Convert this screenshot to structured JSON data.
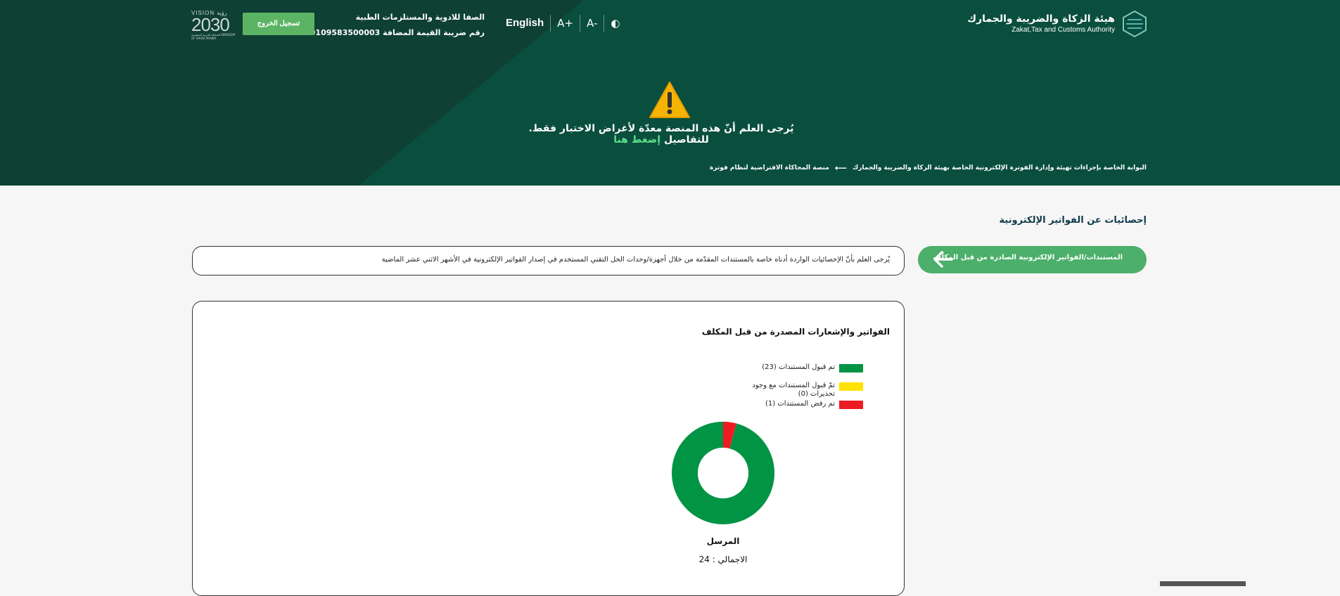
{
  "header": {
    "logo_ar": "هيئة الزكاة والضريبة والجمارك",
    "logo_en": "Zakat,Tax and Customs Authority",
    "language": "English",
    "font_increase": "A+",
    "font_decrease": "A-",
    "contrast": "◐",
    "company_name": "الصفا للادوية والمستلزمات الطبية",
    "vat_number": "رقم ضريبة القيمة المضافة 300109583500003",
    "logout": "تسجيل الخروج",
    "vision_top": "VISION رؤية",
    "vision_year": "2030",
    "vision_sub": "المملكة العربية السعودية KINGDOM OF SAUDI ARABIA"
  },
  "warning": {
    "text": "يُرجى العلم أنّ هذه المنصة معدّة لأغراض الاختبار فقط. للتفاصيل",
    "link": "إضغط هنا"
  },
  "breadcrumb": {
    "item1": "البوابة الخاصة بإجراءات تهيئة وإدارة الفوترة الإلكترونية الخاصة بهيئة الزكاة والضريبة والجمارك",
    "item2": "منصة المحاكاة الافتراضية لنظام فوترة"
  },
  "page_title": "إحصائيات عن الفواتير الإلكترونية",
  "side_button": "المستندات/الفواتير الإلكترونية الصادرة من قبل المكلّف",
  "notice": "يُرجى العلم بأنّ الإحصائيات الواردة أدناه خاصة بالمستندات المقدّمة من خلال أجهزة/وحدات الحل التقني المستخدم في إصدار الفواتير الإلكترونية في الأشهر الاثني عشر الماضية",
  "chart_card": {
    "title": "الفواتير والإشعارات المصدرة من قبل المكلف",
    "legend": [
      {
        "label": "تم قبول المستندات (23)",
        "color": "#009444"
      },
      {
        "label": "تمّ قبول المستندات مع وجود تحذيرات (0)",
        "color": "#ffe200"
      },
      {
        "label": "تم رفض المستندات (1)",
        "color": "#ed1c24"
      }
    ],
    "donut_label": "المرسل",
    "total": "الاجمالي : 24"
  },
  "chart_data": {
    "type": "pie",
    "categories": [
      "تم قبول المستندات",
      "تمّ قبول المستندات مع وجود تحذيرات",
      "تم رفض المستندات"
    ],
    "values": [
      23,
      0,
      1
    ],
    "colors": [
      "#009444",
      "#ffe200",
      "#ed1c24"
    ],
    "title": "الفواتير والإشعارات المصدرة من قبل المكلف"
  }
}
